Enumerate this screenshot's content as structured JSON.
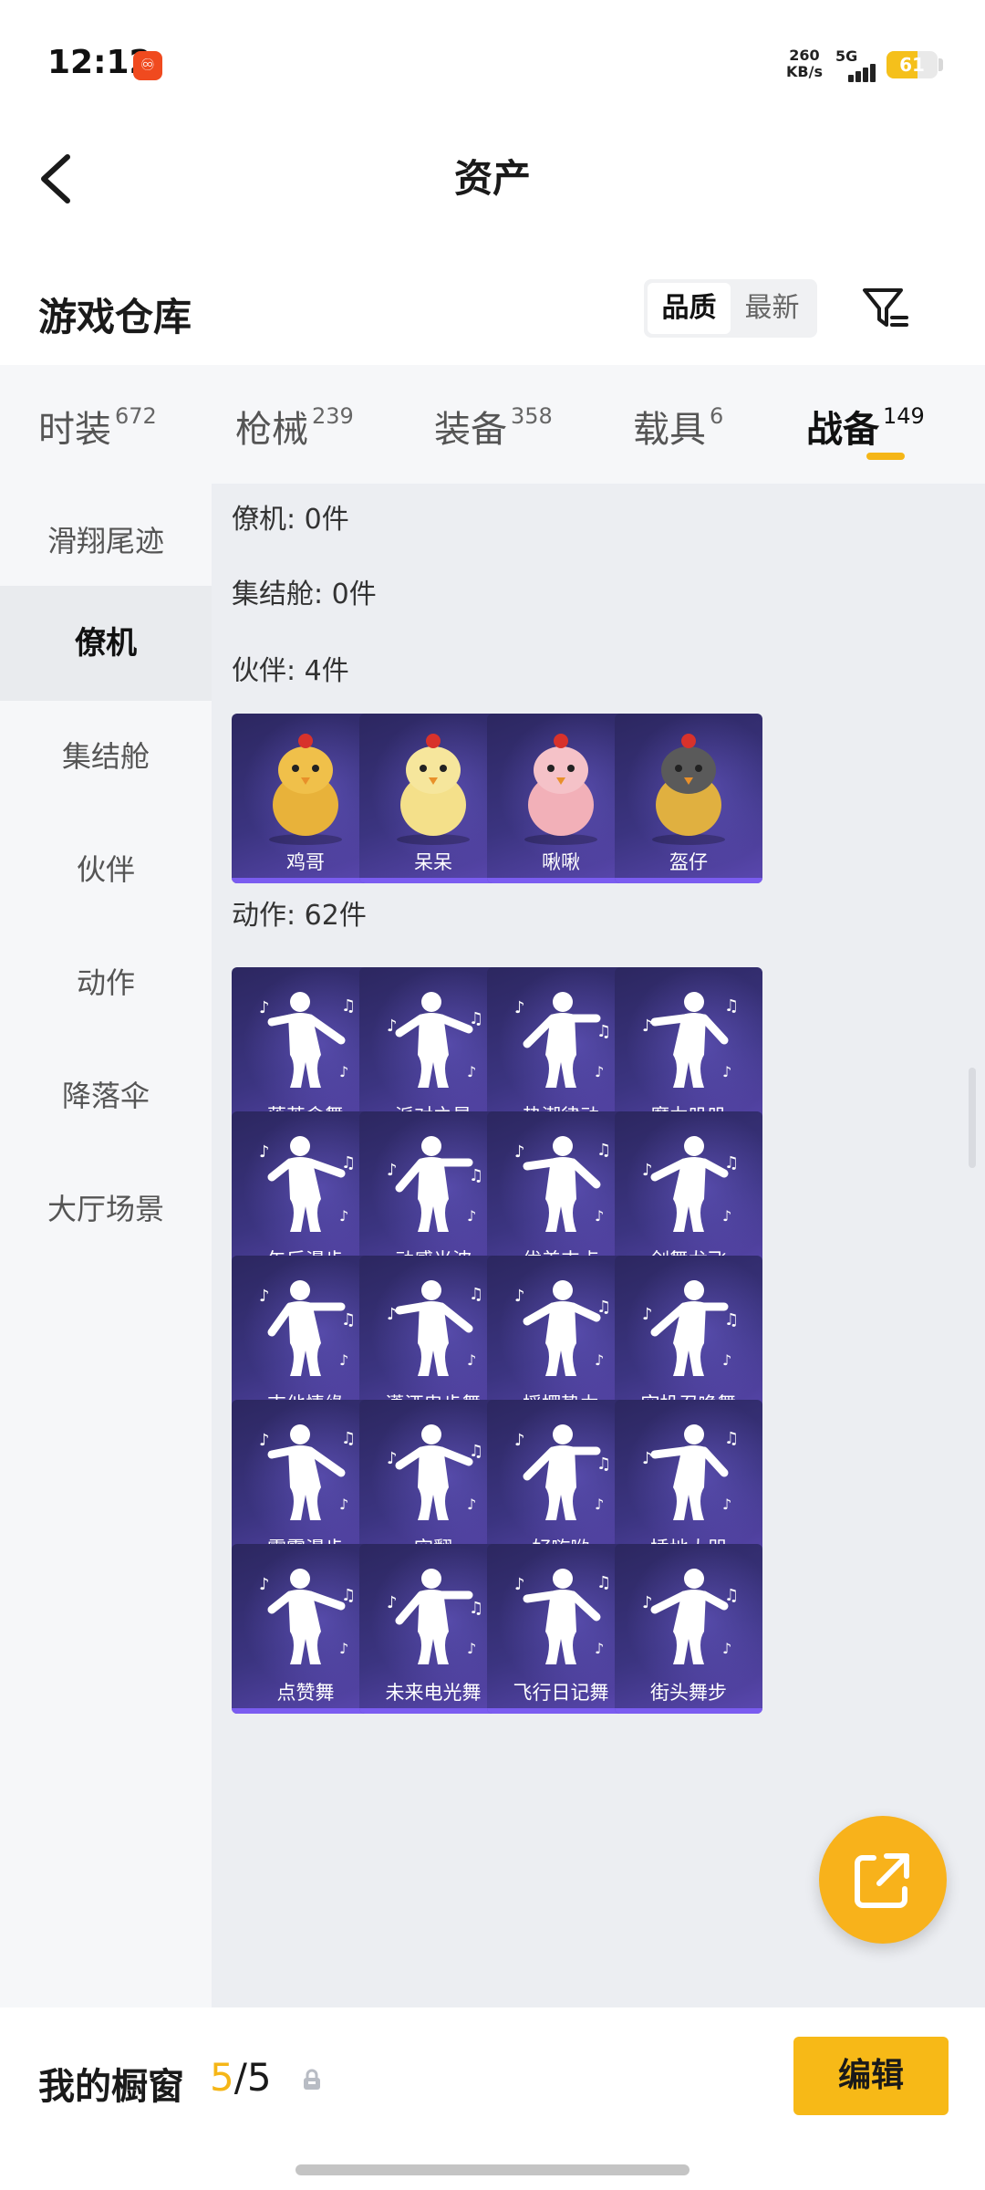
{
  "status_bar": {
    "time": "12:12",
    "net_speed_value": "260",
    "net_speed_unit": "KB/s",
    "network": "5G",
    "battery": "61",
    "battery_level": 0.61
  },
  "top_bar": {
    "title": "资产",
    "back_icon": "chevron-left-icon"
  },
  "warehouse": {
    "title": "游戏仓库",
    "sort_options": [
      "品质",
      "最新"
    ],
    "sort_active": "品质",
    "filter_icon": "filter-icon"
  },
  "category_tabs": [
    {
      "label": "时装",
      "count": "672"
    },
    {
      "label": "枪械",
      "count": "239"
    },
    {
      "label": "装备",
      "count": "358"
    },
    {
      "label": "载具",
      "count": "6"
    },
    {
      "label": "战备",
      "count": "149"
    }
  ],
  "category_active": "战备",
  "sidebar": {
    "items": [
      "滑翔尾迹",
      "僚机",
      "集结舱",
      "伙伴",
      "动作",
      "降落伞",
      "大厅场景"
    ],
    "active": "僚机"
  },
  "sections": {
    "wingman": "僚机: 0件",
    "capsule": "集结舱: 0件",
    "partner": "伙伴: 4件",
    "emote": "动作: 62件"
  },
  "partners": [
    "鸡哥",
    "呆呆",
    "啾啾",
    "盔仔"
  ],
  "emotes": [
    "落英伞舞",
    "派对之星",
    "热潮律动",
    "魔力叽叽",
    "午后漫步",
    "动感光波",
    "优美支点",
    "剑舞龙飞",
    "吉他情缘",
    "潇洒曳步舞",
    "摇摆势力",
    "空投召唤舞",
    "霹雳漫步",
    "空翻",
    "好嗨哟",
    "捶地大哭",
    "点赞舞",
    "未来电光舞",
    "飞行日记舞",
    "街头舞步"
  ],
  "fab_icon": "share-external-icon",
  "bottom_bar": {
    "label": "我的橱窗",
    "count_current": "5",
    "count_sep": "/",
    "count_total": "5",
    "lock_icon": "lock-icon",
    "edit_label": "编辑"
  },
  "colors": {
    "accent": "#f5b617",
    "card_bg": "#3b3480",
    "card_accent": "#7a5cf0"
  }
}
